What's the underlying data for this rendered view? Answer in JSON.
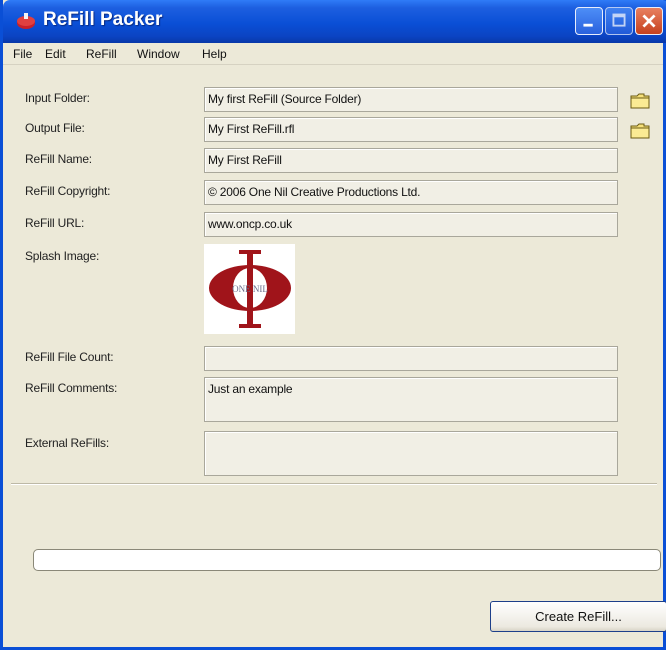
{
  "window": {
    "title": "ReFill Packer"
  },
  "menu": {
    "items": [
      "File",
      "Edit",
      "ReFill",
      "Window",
      "Help"
    ]
  },
  "form": {
    "input_folder": {
      "label": "Input Folder:",
      "value": "My first ReFill (Source Folder)"
    },
    "output_file": {
      "label": "Output File:",
      "value": "My First ReFill.rfl"
    },
    "refill_name": {
      "label": "ReFill Name:",
      "value": "My First ReFill"
    },
    "refill_copyright": {
      "label": "ReFill Copyright:",
      "value": "© 2006 One Nil Creative Productions Ltd."
    },
    "refill_url": {
      "label": "ReFill URL:",
      "value": "www.oncp.co.uk"
    },
    "splash_image": {
      "label": "Splash Image:",
      "logo_text": "ONE NIL"
    },
    "refill_file_count": {
      "label": "ReFill File Count:",
      "value": ""
    },
    "refill_comments": {
      "label": "ReFill Comments:",
      "value": "Just an example"
    },
    "external_refills": {
      "label": "External ReFills:",
      "value": ""
    }
  },
  "progress": {
    "value": 0
  },
  "actions": {
    "create_label": "Create ReFill..."
  },
  "colors": {
    "titlebar": "#0a4fd6",
    "window_bg": "#ece9d8",
    "logo_red": "#a0141a"
  },
  "icons": {
    "browse": "folder-icon",
    "app": "refill-app-icon"
  }
}
